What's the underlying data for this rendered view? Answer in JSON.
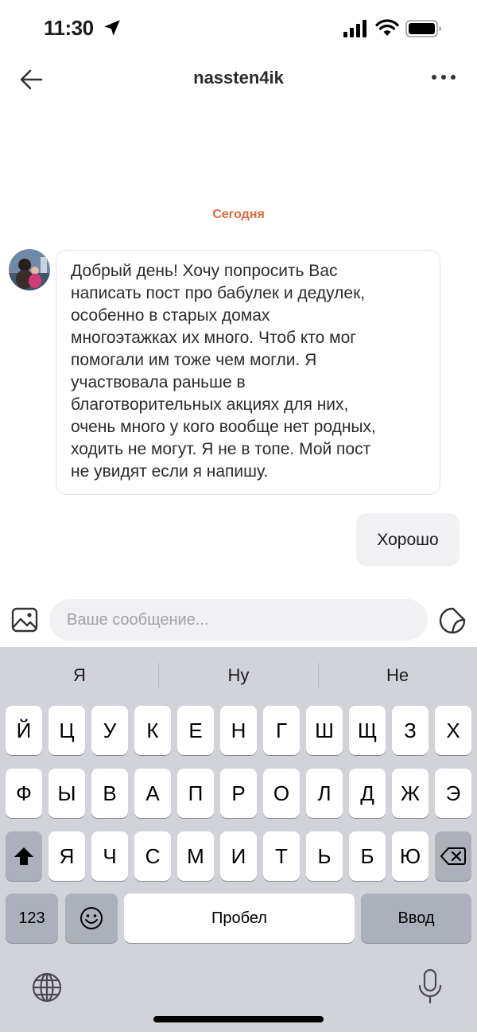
{
  "status_bar": {
    "time": "11:30",
    "icons": [
      "location-arrow-icon",
      "cellular-signal-icon",
      "wifi-icon",
      "battery-icon"
    ]
  },
  "header": {
    "title": "nassten4ik",
    "back_icon": "arrow-left-icon",
    "more_icon": "more-dots-icon"
  },
  "chat": {
    "date_label": "Сегодня",
    "incoming": {
      "avatar_icon": "user-avatar",
      "lines": [
        "Добрый день! Хочу попросить Вас",
        "написать пост про бабулек и дедулек,",
        "особенно в старых домах",
        "многоэтажках их много. Чтоб кто мог",
        "помогали им тоже чем могли. Я",
        "участвовала раньше в",
        "благотворительных акциях для них,",
        "очень много у кого вообще нет родных,",
        "ходить не могут. Я не в топе. Мой пост",
        "не увидят если я напишу."
      ]
    },
    "outgoing": {
      "text": "Хорошо"
    }
  },
  "composer": {
    "placeholder": "Ваше сообщение...",
    "value": "",
    "gallery_icon": "image-icon",
    "sticker_icon": "sticker-icon"
  },
  "keyboard": {
    "suggestions": [
      "Я",
      "Ну",
      "Не"
    ],
    "row1": [
      "Й",
      "Ц",
      "У",
      "К",
      "Е",
      "Н",
      "Г",
      "Ш",
      "Щ",
      "З",
      "Х"
    ],
    "row2": [
      "Ф",
      "Ы",
      "В",
      "А",
      "П",
      "Р",
      "О",
      "Л",
      "Д",
      "Ж",
      "Э"
    ],
    "row3": [
      "Я",
      "Ч",
      "С",
      "М",
      "И",
      "Т",
      "Ь",
      "Б",
      "Ю"
    ],
    "shift_icon": "shift-icon",
    "backspace_icon": "backspace-icon",
    "numbers_label": "123",
    "emoji_icon": "emoji-icon",
    "space_label": "Пробел",
    "return_label": "Ввод",
    "globe_icon": "globe-icon",
    "mic_icon": "microphone-icon"
  },
  "colors": {
    "accent": "#e06a3d",
    "bubble_out": "#f1f1f3",
    "keyboard_bg": "#d1d3d9",
    "key_dark": "#abb0bb"
  }
}
